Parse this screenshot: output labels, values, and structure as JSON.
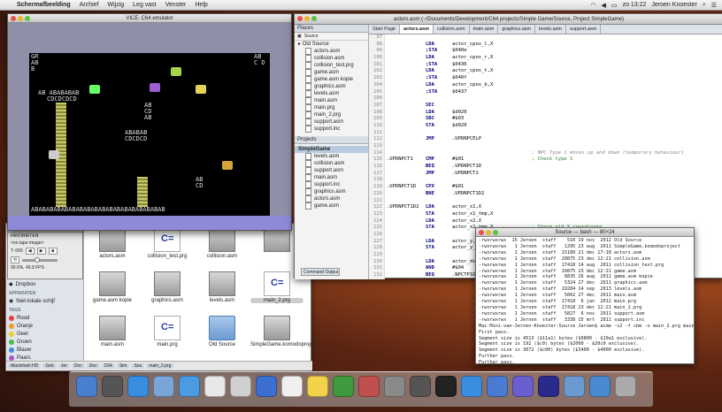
{
  "menubar": {
    "apple": "",
    "app_name": "Schermafbeelding",
    "items": [
      "Archief",
      "Wijzig",
      "Leg vast",
      "Venster",
      "Help"
    ],
    "clock": "zo 13:22",
    "user": "Jeroen Knoester"
  },
  "vice": {
    "title": "VICE: C64 emulator",
    "screen_text": {
      "top_left": "GR\nAB\nB",
      "top_right": "AB\nC D",
      "row1": "AB ABABABAB",
      "row2": "CDCDCDCD",
      "mid": "AB\nCD\nAB",
      "tower": "ABABAB\nCDCDCD",
      "right_top": "AB\nCD",
      "bottom": "ABABABABABABABABABABABABABABABABABAB"
    },
    "border_color": "#8f8fa8",
    "screen_color": "#000000",
    "bottom_color": "#8e8ad8"
  },
  "vice_control": {
    "title": "VICE: Control",
    "image_label": "<no tape image>",
    "counter": "T: 000",
    "status": "99.6%, 49.9 FPS"
  },
  "source_window": {
    "title": "actors.asm (~/Documents/Development/C64 projects/Simple Game/Source, Project SimpleGame)",
    "places_header": "Places",
    "places_toolbar": "Source",
    "folder_old": "Old Source",
    "files": [
      "actors.asm",
      "collision.asm",
      "collision_test.prg",
      "game.asm",
      "game.asm kopie",
      "graphics.asm",
      "levels.asm",
      "main.asm",
      "main.prg",
      "main_2.prg",
      "support.asm",
      "support.inc"
    ],
    "projects_header": "Projects",
    "project_name": "SimpleGame",
    "project_files": [
      "levels.asm",
      "collision.asm",
      "support.asm",
      "main.asm",
      "support.inc",
      "graphics.asm",
      "actors.asm",
      "game.asm"
    ],
    "tabs": [
      "Start Page",
      "actors.asm",
      "collision.asm",
      "main.asm",
      "graphics.asm",
      "levels.asm",
      "support.asm"
    ],
    "active_tab": "actors.asm",
    "command_output": "Command Output"
  },
  "code": [
    {
      "n": "97",
      "lab": "",
      "op": "",
      "arg": "",
      "com": ""
    },
    {
      "n": "98",
      "lab": "",
      "op": "LDA",
      "arg": "actor_cpos_l,X",
      "com": ""
    },
    {
      "n": "99",
      "lab": "",
      "op": ";STA",
      "arg": "$040e",
      "com": ""
    },
    {
      "n": "100",
      "lab": "",
      "op": "LDA",
      "arg": "actor_cpos_r,X",
      "com": ""
    },
    {
      "n": "101",
      "lab": "",
      "op": ";STA",
      "arg": "$0436",
      "com": ""
    },
    {
      "n": "102",
      "lab": "",
      "op": "LDA",
      "arg": "actor_cpos_t,X",
      "com": ""
    },
    {
      "n": "103",
      "lab": "",
      "op": ";STA",
      "arg": "$040f",
      "com": ""
    },
    {
      "n": "104",
      "lab": "",
      "op": "LDA",
      "arg": "actor_cpos_b,X",
      "com": ""
    },
    {
      "n": "105",
      "lab": "",
      "op": ";STA",
      "arg": "$0437",
      "com": ""
    },
    {
      "n": "106",
      "lab": "",
      "op": "",
      "arg": "",
      "com": ""
    },
    {
      "n": "107",
      "lab": "",
      "op": "SEC",
      "arg": "",
      "com": ""
    },
    {
      "n": "108",
      "lab": "",
      "op": "LDA",
      "arg": "$d020",
      "com": ""
    },
    {
      "n": "109",
      "lab": "",
      "op": "SBC",
      "arg": "#$03",
      "com": ""
    },
    {
      "n": "110",
      "lab": "",
      "op": "STA",
      "arg": "$d020",
      "com": ""
    },
    {
      "n": "111",
      "lab": "",
      "op": "",
      "arg": "",
      "com": ""
    },
    {
      "n": "112",
      "lab": "",
      "op": "JMP",
      "arg": ".UPDNPCELP",
      "com": ""
    },
    {
      "n": "113",
      "lab": "",
      "op": "",
      "arg": "",
      "com": ""
    },
    {
      "n": "114",
      "lab": "",
      "op": "",
      "arg": "",
      "com": "; NPC Type 1 moves up and down (temporary behaviour)",
      "cmt": true
    },
    {
      "n": "115",
      "lab": ".UPDNPCT1",
      "op": "CMP",
      "arg": "#$01",
      "com": "; Check type 1"
    },
    {
      "n": "116",
      "lab": "",
      "op": "BEQ",
      "arg": ".UPDNPCT1D",
      "com": ""
    },
    {
      "n": "117",
      "lab": "",
      "op": "JMP",
      "arg": ".UPDNPCT2",
      "com": ""
    },
    {
      "n": "118",
      "lab": "",
      "op": "",
      "arg": "",
      "com": ""
    },
    {
      "n": "119",
      "lab": ".UPDNPCT1D",
      "op": "CPX",
      "arg": "#$01",
      "com": ""
    },
    {
      "n": "120",
      "lab": "",
      "op": "BNE",
      "arg": ".UPDNPCT1D2",
      "com": ""
    },
    {
      "n": "121",
      "lab": "",
      "op": "",
      "arg": "",
      "com": ""
    },
    {
      "n": "122",
      "lab": ".UPDNPCT1D2",
      "op": "LDA",
      "arg": "actor_x1,X",
      "com": ""
    },
    {
      "n": "123",
      "lab": "",
      "op": "STA",
      "arg": "actor_x1_tmp,X",
      "com": ""
    },
    {
      "n": "124",
      "lab": "",
      "op": "LDA",
      "arg": "actor_x2,X",
      "com": ""
    },
    {
      "n": "125",
      "lab": "",
      "op": "STA",
      "arg": "actor_x2_tmp,X",
      "com": "; Store old X coordinate"
    },
    {
      "n": "126",
      "lab": "",
      "op": "",
      "arg": "",
      "com": ""
    },
    {
      "n": "127",
      "lab": "",
      "op": "LDA",
      "arg": "actor_y,X",
      "com": ""
    },
    {
      "n": "128",
      "lab": "",
      "op": "STA",
      "arg": "actor_y_tmp,X",
      "com": "; Store old Y coordinate"
    },
    {
      "n": "129",
      "lab": "",
      "op": "",
      "arg": "",
      "com": ""
    },
    {
      "n": "130",
      "lab": "",
      "op": "LDA",
      "arg": "actor_dir,X",
      "com": ""
    },
    {
      "n": "131",
      "lab": "",
      "op": "AND",
      "arg": "#$04",
      "com": ""
    },
    {
      "n": "132",
      "lab": "",
      "op": "BEQ",
      "arg": ".NPCTP1DN",
      "com": ""
    }
  ],
  "terminal": {
    "title": "Source — bash — 80×24",
    "lines": [
      "-rwxrwxrwx  15 Jeroen  staff    510 19 nov  2012 Old Source",
      "-rwxrwxrwx   1 Jeroen  staff   1295 23 aug  2011 SimpleGame.komodoproject",
      "-rwxrwxrwx   1 Jeroen  staff  15189 21 dec 17:18 actors.asm",
      "-rwxrwxrwx   1 Jeroen  staff  20875 23 dec 12:21 collision.asm",
      "-rwxrwxrwx   1 Jeroen  staff  17418 14 aug  2011 collision_test.prg",
      "-rwxrwxrwx   1 Jeroen  staff  10875 23 dec 12:21 game.asm",
      "-rwxrwxrwx   1 Jeroen  staff   8835 26 aug  2011 game.asm kopie",
      "-rwxrwxrwx   1 Jeroen  staff   5324 27 dec  2011 graphics.asm",
      "-rwxrwxrwx   1 Jeroen  staff  19284 14 sep  2013 levels.asm",
      "-rwxrwxrwx   1 Jeroen  staff   5002 27 dec  2011 main.asm",
      "-rwxrwxrwx   1 Jeroen  staff  17418  6 jan  2012 main.prg",
      "-rwxrwxrwx   1 Jeroen  staff  17418 23 dec 12:21 main_2.prg",
      "-rwxrwxrwx   1 Jeroen  staff   5827  6 nov  2011 support.asm",
      "-rwxrwxrwx   1 Jeroen  staff   3338 15 mrt  2011 support.inc",
      "Mac-Mini-van-Jeroen-Knoester:Source Jeroen$ acme -v2 -f cbm -o main_2.prg main.asm",
      "First pass.",
      "Segment size is 4513 ($11a1) bytes ($0800 - $19a1 exclusive).",
      "Segment size is 192 ($c0) bytes ($2000 - $20c0 exclusive).",
      "Segment size is 3072 ($c00) bytes ($3400 - $4000 exclusive).",
      "Further pass.",
      "Further pass.",
      "Saving 17408 ($4400) bytes ($0800 - $4c00 exclusive).",
      "Mac-Mini-van-Jeroen-Knoester:Source Jeroen$ "
    ]
  },
  "finder": {
    "sidebar": {
      "favorites_header": "FAVORIETEN",
      "favorites": [
        "Dropbox"
      ],
      "devices_header": "APPARATEN",
      "devices": [
        "Niet-lokale schijf"
      ],
      "tags_header": "TAGS",
      "tags": [
        {
          "label": "Rood",
          "color": "#e0443e"
        },
        {
          "label": "Oranje",
          "color": "#f39a2b"
        },
        {
          "label": "Geel",
          "color": "#e9cf2a"
        },
        {
          "label": "Groen",
          "color": "#4cba4a"
        },
        {
          "label": "Blauw",
          "color": "#3f8be0"
        },
        {
          "label": "Paars",
          "color": "#a55ac4"
        },
        {
          "label": "Grijs",
          "color": "#9a9a9a"
        }
      ]
    },
    "files": [
      {
        "label": "actors.asm",
        "kind": "asm"
      },
      {
        "label": "collision_test.prg",
        "kind": "prg"
      },
      {
        "label": "collision.asm",
        "kind": "asm"
      },
      {
        "label": "",
        "kind": "asm"
      },
      {
        "label": "game.asm kopie",
        "kind": "asm"
      },
      {
        "label": "graphics.asm",
        "kind": "asm"
      },
      {
        "label": "levels.asm",
        "kind": "asm"
      },
      {
        "label": "main_2.prg",
        "kind": "prg",
        "selected": true
      },
      {
        "label": "main.asm",
        "kind": "asm"
      },
      {
        "label": "main.prg",
        "kind": "prg"
      },
      {
        "label": "Old Source",
        "kind": "folder"
      },
      {
        "label": "SimpleGame.komodoproject",
        "kind": "asm"
      }
    ],
    "pathbar": [
      "Macintosh HD",
      "Geb",
      "Jer",
      "Doc",
      "Dev",
      "C64",
      "Sim",
      "Sou",
      "main_2.prg"
    ]
  },
  "dock": {
    "icons": [
      "finder-icon",
      "launchpad-icon",
      "safari-icon",
      "mail-icon",
      "itunes-icon",
      "ical-icon",
      "vmware-icon",
      "xcode-icon",
      "textedit-icon",
      "notes-icon",
      "komodo-icon",
      "photos-icon",
      "sysprefs-icon",
      "activity-icon",
      "terminal-icon",
      "appstore-icon",
      "app-icon",
      "app2-icon",
      "vice-icon",
      "folder-icon",
      "downloads-icon",
      "trash-icon"
    ]
  }
}
